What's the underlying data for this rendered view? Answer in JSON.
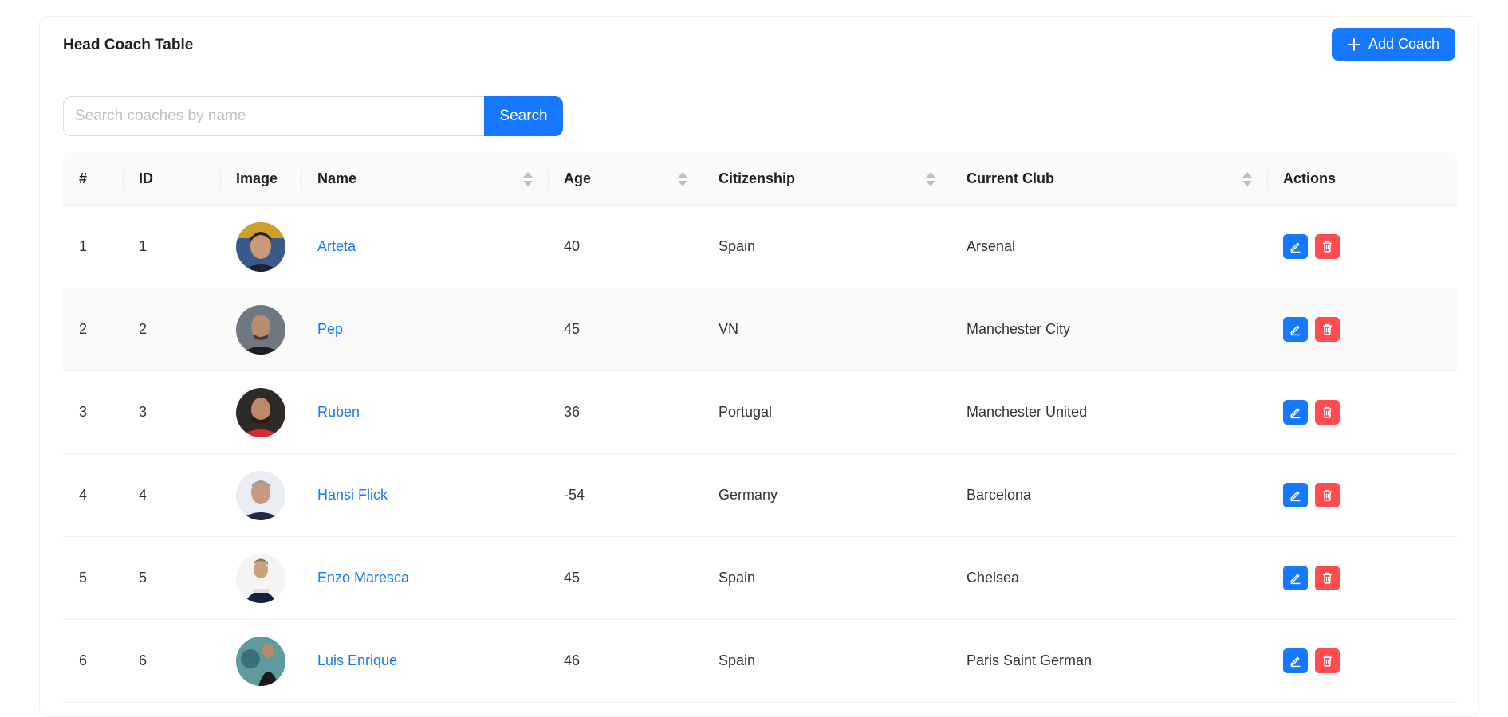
{
  "header": {
    "title": "Head Coach Table",
    "add_label": "Add Coach"
  },
  "search": {
    "placeholder": "Search coaches by name",
    "button_label": "Search"
  },
  "table": {
    "columns": [
      "#",
      "ID",
      "Image",
      "Name",
      "Age",
      "Citizenship",
      "Current Club",
      "Actions"
    ],
    "rows": [
      {
        "index": "1",
        "id": "1",
        "name": "Arteta",
        "age": "40",
        "citizenship": "Spain",
        "club": "Arsenal"
      },
      {
        "index": "2",
        "id": "2",
        "name": "Pep",
        "age": "45",
        "citizenship": "VN",
        "club": "Manchester City"
      },
      {
        "index": "3",
        "id": "3",
        "name": "Ruben",
        "age": "36",
        "citizenship": "Portugal",
        "club": "Manchester United"
      },
      {
        "index": "4",
        "id": "4",
        "name": "Hansi Flick",
        "age": "-54",
        "citizenship": "Germany",
        "club": "Barcelona"
      },
      {
        "index": "5",
        "id": "5",
        "name": "Enzo Maresca",
        "age": "45",
        "citizenship": "Spain",
        "club": "Chelsea"
      },
      {
        "index": "6",
        "id": "6",
        "name": "Luis Enrique",
        "age": "46",
        "citizenship": "Spain",
        "club": "Paris Saint German"
      }
    ]
  },
  "colors": {
    "primary": "#1677ff",
    "danger": "#ff4d4f"
  },
  "icons": {
    "add": "plus-icon",
    "sort": "sort-icon",
    "edit": "edit-icon",
    "delete": "trash-icon"
  }
}
